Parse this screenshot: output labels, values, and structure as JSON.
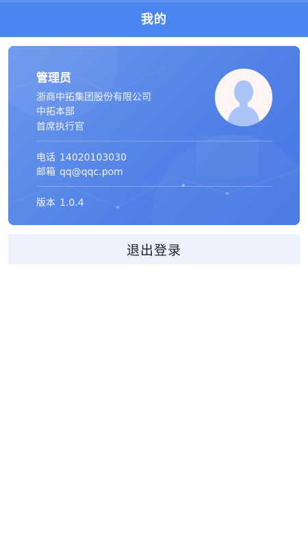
{
  "header": {
    "title": "我的"
  },
  "profile": {
    "name": "管理员",
    "company": "浙商中拓集团股份有限公司",
    "department": "中拓本部",
    "position": "首席执行官",
    "phone_label": "电话",
    "phone": "14020103030",
    "email_label": "邮箱",
    "email": "qq@qqc.pom",
    "version_label": "版本",
    "version": "1.0.4",
    "avatar_icon": "user-silhouette-icon"
  },
  "actions": {
    "logout_label": "退出登录"
  },
  "colors": {
    "header": "#4a86f0",
    "card_start": "#6b97ec",
    "card_end": "#4577e3",
    "avatar_bg": "#fdf5f4",
    "avatar_figure": "#a9c4f5",
    "logout_bg": "#edf1fb"
  }
}
